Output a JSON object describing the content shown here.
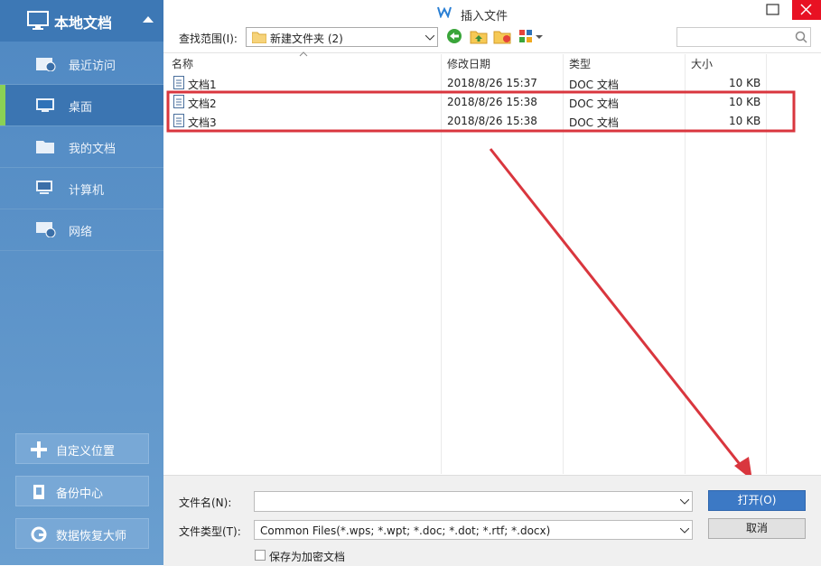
{
  "sidebar": {
    "header": "本地文档",
    "items": [
      {
        "label": "最近访问"
      },
      {
        "label": "桌面"
      },
      {
        "label": "我的文档"
      },
      {
        "label": "计算机"
      },
      {
        "label": "网络"
      }
    ],
    "buttons": [
      {
        "label": "自定义位置"
      },
      {
        "label": "备份中心"
      },
      {
        "label": "数据恢复大师"
      }
    ]
  },
  "dialog": {
    "title": "插入文件",
    "lookin_label": "查找范围(I):",
    "lookin_value": "新建文件夹 (2)",
    "columns": [
      "名称",
      "修改日期",
      "类型",
      "大小"
    ],
    "files": [
      {
        "name": "文档1",
        "date": "2018/8/26 15:37",
        "type": "DOC 文档",
        "size": "10 KB"
      },
      {
        "name": "文档2",
        "date": "2018/8/26 15:38",
        "type": "DOC 文档",
        "size": "10 KB"
      },
      {
        "name": "文档3",
        "date": "2018/8/26 15:38",
        "type": "DOC 文档",
        "size": "10 KB"
      }
    ],
    "filename_label": "文件名(N):",
    "filename_value": "",
    "filetype_label": "文件类型(T):",
    "filetype_value": "Common Files(*.wps; *.wpt; *.doc; *.dot; *.rtf; *.docx)",
    "encrypt_label": "保存为加密文档",
    "open_label": "打开(O)",
    "cancel_label": "取消"
  },
  "colors": {
    "sidebar": "#5b92c8",
    "accent": "#8ad155",
    "highlight_box": "#d9363e",
    "open_button": "#3c79c5"
  },
  "icons": [
    "monitor-icon",
    "recent-icon",
    "desktop-icon",
    "folder-icon",
    "computer-icon",
    "network-icon",
    "plus-icon",
    "backup-icon",
    "recovery-icon",
    "wps-icon",
    "back-icon",
    "up-folder-icon",
    "new-folder-icon",
    "view-icon",
    "search-icon",
    "doc-file-icon"
  ]
}
